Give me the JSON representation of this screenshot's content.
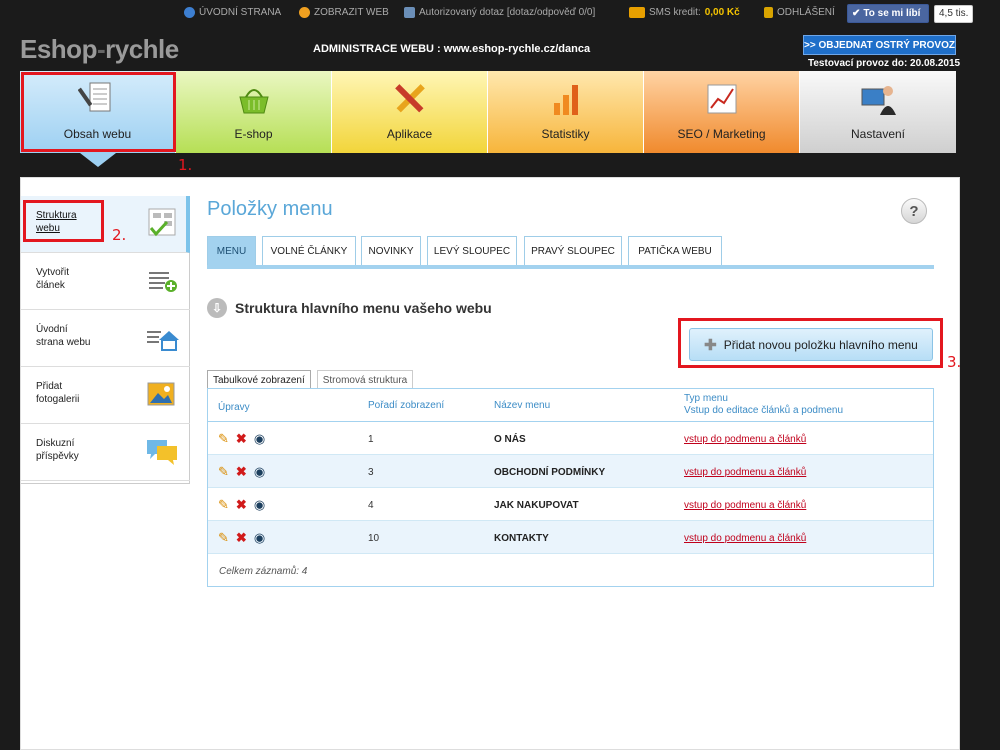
{
  "topbar": {
    "home": "ÚVODNÍ STRANA",
    "view_web": "ZOBRAZIT WEB",
    "query": "Autorizovaný dotaz [dotaz/odpověď 0/0]",
    "sms_label": "SMS kredit:",
    "sms_value": "0,00 Kč",
    "logout": "ODHLÁŠENÍ",
    "like": "To se mi líbí",
    "like_count": "4,5 tis."
  },
  "header": {
    "logo_part1": "Eshop",
    "logo_dash": "-",
    "logo_part2": "rychle",
    "admin_title": "ADMINISTRACE WEBU : www.eshop-rychle.cz/danca",
    "order_button": ">> OBJEDNAT OSTRÝ PROVOZ",
    "test_mode": "Testovací provoz do: 20.08.2015"
  },
  "mainnav": [
    "Obsah webu",
    "E-shop",
    "Aplikace",
    "Statistiky",
    "SEO / Marketing",
    "Nastavení"
  ],
  "annotations": [
    "1.",
    "2.",
    "3."
  ],
  "sidebar": [
    {
      "line1": "Struktura",
      "line2": "webu"
    },
    {
      "line1": "Vytvořit",
      "line2": "článek"
    },
    {
      "line1": "Úvodní",
      "line2": "strana webu"
    },
    {
      "line1": "Přidat",
      "line2": "fotogalerii"
    },
    {
      "line1": "Diskuzní",
      "line2": "příspěvky"
    }
  ],
  "page": {
    "title": "Položky menu",
    "help": "?",
    "tabs": [
      "MENU",
      "VOLNÉ ČLÁNKY",
      "NOVINKY",
      "LEVÝ SLOUPEC",
      "PRAVÝ SLOUPEC",
      "PATIČKA WEBU"
    ],
    "section_title": "Struktura hlavního menu vašeho webu",
    "add_button": "Přidat novou položku hlavního menu",
    "view_tabs": [
      "Tabulkové zobrazení",
      "Stromová struktura"
    ]
  },
  "table": {
    "headers": {
      "actions": "Úpravy",
      "order": "Pořadí zobrazení",
      "name": "Název menu",
      "type_line1": "Typ menu",
      "type_line2": "Vstup do editace článků a podmenu"
    },
    "rows": [
      {
        "order": "1",
        "name": "O NÁS",
        "link": "vstup do podmenu a článků"
      },
      {
        "order": "3",
        "name": "OBCHODNÍ PODMÍNKY",
        "link": "vstup do podmenu a článků"
      },
      {
        "order": "4",
        "name": "JAK NAKUPOVAT",
        "link": "vstup do podmenu a článků"
      },
      {
        "order": "10",
        "name": "KONTAKTY",
        "link": "vstup do podmenu a článků"
      }
    ],
    "footer": "Celkem záznamů: 4"
  },
  "icons": {
    "home": "info-icon",
    "view": "flower-icon",
    "query": "speech-icon",
    "sms": "sms-icon",
    "logout": "lock-icon",
    "edit": "pencil-icon",
    "delete": "cross-icon",
    "view_row": "eye-icon"
  },
  "colors": {
    "accent": "#5aa7d8",
    "annotation": "#e3171f",
    "link": "#c0001b"
  }
}
